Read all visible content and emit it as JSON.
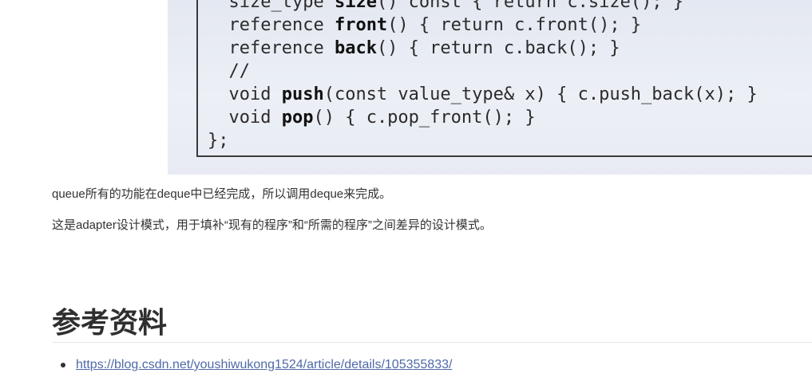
{
  "slide": {
    "code_lines": [
      [
        {
          "t": "  size_type "
        },
        {
          "t": "size",
          "b": true
        },
        {
          "t": "() const { return c.size(); }"
        }
      ],
      [
        {
          "t": "  reference "
        },
        {
          "t": "front",
          "b": true
        },
        {
          "t": "() { return c.front(); }"
        }
      ],
      [
        {
          "t": "  reference "
        },
        {
          "t": "back",
          "b": true
        },
        {
          "t": "() { return c.back(); }"
        }
      ],
      [
        {
          "t": "  //"
        }
      ],
      [
        {
          "t": "  void "
        },
        {
          "t": "push",
          "b": true
        },
        {
          "t": "(const value_type& x) { c.push_back(x); }"
        }
      ],
      [
        {
          "t": "  void "
        },
        {
          "t": "pop",
          "b": true
        },
        {
          "t": "() { c.pop_front(); }"
        }
      ],
      [
        {
          "t": "};"
        }
      ]
    ]
  },
  "article": {
    "paragraph_1": "queue所有的功能在deque中已经完成，所以调用deque来完成。",
    "paragraph_2": "这是adapter设计模式，用于填补“现有的程序”和“所需的程序”之间差异的设计模式。",
    "references_heading": "参考资料",
    "references": [
      {
        "text": "https://blog.csdn.net/youshiwukong1524/article/details/105355833/"
      }
    ]
  }
}
